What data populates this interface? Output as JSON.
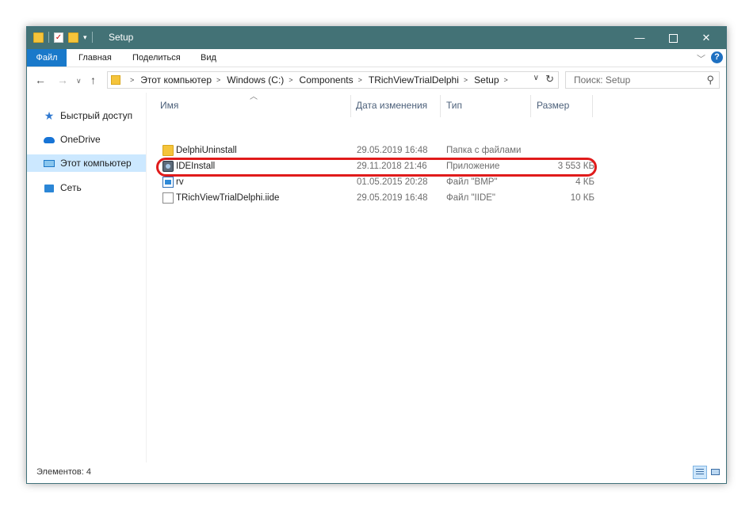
{
  "window": {
    "title": "Setup",
    "minimize_glyph": "—",
    "close_glyph": "✕"
  },
  "ribbon": {
    "tabs": [
      "Файл",
      "Главная",
      "Поделиться",
      "Вид"
    ],
    "help_glyph": "?"
  },
  "address": {
    "crumbs": [
      "Этот компьютер",
      "Windows (C:)",
      "Components",
      "TRichViewTrialDelphi",
      "Setup"
    ]
  },
  "search": {
    "placeholder": "Поиск: Setup"
  },
  "sidebar": {
    "items": [
      {
        "label": "Быстрый доступ",
        "icon": "star-icon"
      },
      {
        "label": "OneDrive",
        "icon": "onedrive-cloud-icon"
      },
      {
        "label": "Этот компьютер",
        "icon": "computer-icon",
        "selected": true
      },
      {
        "label": "Сеть",
        "icon": "network-icon"
      }
    ]
  },
  "columns": {
    "name": "Имя",
    "date": "Дата изменения",
    "type": "Тип",
    "size": "Размер"
  },
  "files": [
    {
      "name": "DelphiUninstall",
      "date": "29.05.2019 16:48",
      "type": "Папка с файлами",
      "size": "",
      "icon": "folder-icon"
    },
    {
      "name": "IDEInstall",
      "date": "29.11.2018 21:46",
      "type": "Приложение",
      "size": "3 553 КБ",
      "icon": "application-icon",
      "highlighted": true
    },
    {
      "name": "rv",
      "date": "01.05.2015 20:28",
      "type": "Файл \"BMP\"",
      "size": "4 КБ",
      "icon": "bitmap-file-icon"
    },
    {
      "name": "TRichViewTrialDelphi.iide",
      "date": "29.05.2019 16:48",
      "type": "Файл \"IIDE\"",
      "size": "10 КБ",
      "icon": "document-icon"
    }
  ],
  "status": {
    "items_count": "Элементов: 4"
  },
  "colors": {
    "titlebar": "#437276",
    "file_tab": "#1979ca",
    "selected_nav": "#cce8ff",
    "highlight_ring": "#e01b1b"
  }
}
